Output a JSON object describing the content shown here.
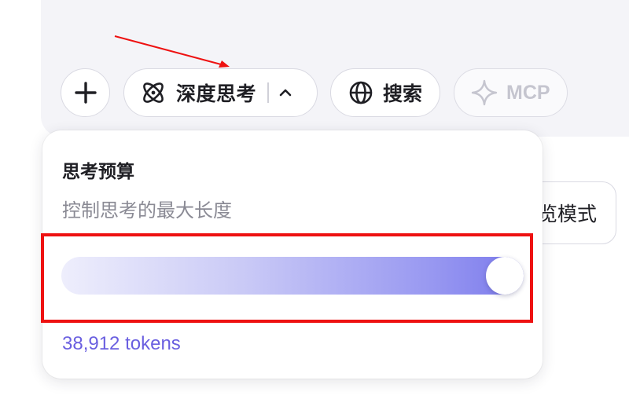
{
  "toolbar": {
    "add": {
      "icon": "plus-icon"
    },
    "deep_think": {
      "icon": "atom-icon",
      "label": "深度思考",
      "toggle_icon": "chevron-up-icon"
    },
    "search": {
      "icon": "globe-icon",
      "label": "搜索"
    },
    "mcp": {
      "icon": "sparkle-icon",
      "label": "MCP",
      "enabled": false
    }
  },
  "side_button": {
    "label": "览模式"
  },
  "thinking_budget": {
    "title": "思考预算",
    "subtitle": "控制思考的最大长度",
    "slider_fraction": 1.0,
    "value_label": "38,912 tokens",
    "accent_color": "#6a5fe0"
  },
  "annotations": {
    "highlight_color": "#ee1111"
  }
}
